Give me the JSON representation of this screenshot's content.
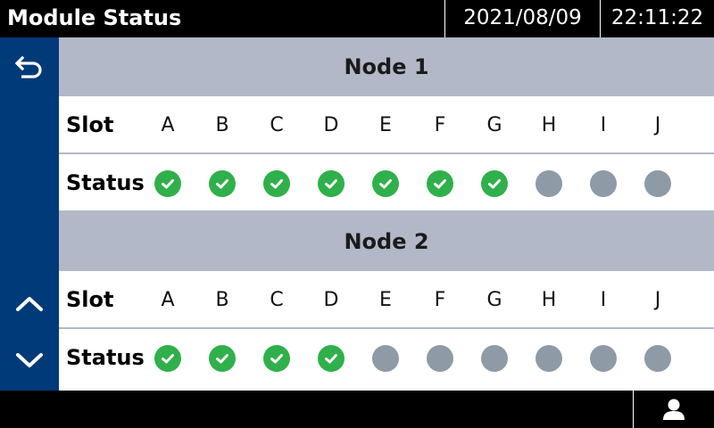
{
  "header": {
    "title": "Module Status",
    "date": "2021/08/09",
    "time": "22:11:22"
  },
  "sidebar": {
    "back_icon": "back-arrow-icon",
    "up_icon": "chevron-up-icon",
    "down_icon": "chevron-down-icon"
  },
  "labels": {
    "slot": "Slot",
    "status": "Status"
  },
  "colors": {
    "header_bg": "#000000",
    "sidebar_bg": "#003a78",
    "node_bar": "#b2b8c8",
    "status_ok": "#2fb04a",
    "status_inactive": "#8e9aa6"
  },
  "nodes": [
    {
      "title": "Node 1",
      "slots": [
        {
          "letter": "A",
          "status": "ok"
        },
        {
          "letter": "B",
          "status": "ok"
        },
        {
          "letter": "C",
          "status": "ok"
        },
        {
          "letter": "D",
          "status": "ok"
        },
        {
          "letter": "E",
          "status": "ok"
        },
        {
          "letter": "F",
          "status": "ok"
        },
        {
          "letter": "G",
          "status": "ok"
        },
        {
          "letter": "H",
          "status": "inactive"
        },
        {
          "letter": "I",
          "status": "inactive"
        },
        {
          "letter": "J",
          "status": "inactive"
        }
      ]
    },
    {
      "title": "Node 2",
      "slots": [
        {
          "letter": "A",
          "status": "ok"
        },
        {
          "letter": "B",
          "status": "ok"
        },
        {
          "letter": "C",
          "status": "ok"
        },
        {
          "letter": "D",
          "status": "ok"
        },
        {
          "letter": "E",
          "status": "inactive"
        },
        {
          "letter": "F",
          "status": "inactive"
        },
        {
          "letter": "G",
          "status": "inactive"
        },
        {
          "letter": "H",
          "status": "inactive"
        },
        {
          "letter": "I",
          "status": "inactive"
        },
        {
          "letter": "J",
          "status": "inactive"
        }
      ]
    }
  ],
  "footer": {
    "user_icon": "user-icon"
  }
}
